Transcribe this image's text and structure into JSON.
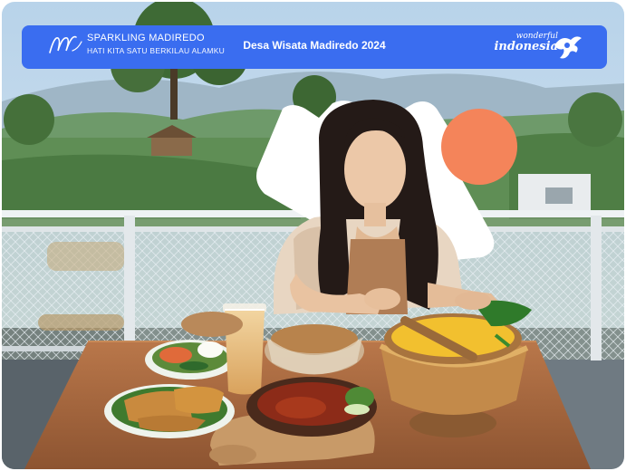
{
  "banner": {
    "brand_name": "SPARKLING MADIREDO",
    "brand_tagline": "HATI KITA SATU BERKILAU ALAMKU",
    "title": "Desa Wisata Madiredo 2024",
    "partner_small": "wonderful",
    "partner_big": "indonesia"
  },
  "colors": {
    "banner": "#3a6df0",
    "accent_circle": "#f4845a",
    "frame": "#3a6df0"
  },
  "icons": [
    "brand-m-logo-icon",
    "wonderful-indonesia-garuda-icon"
  ]
}
